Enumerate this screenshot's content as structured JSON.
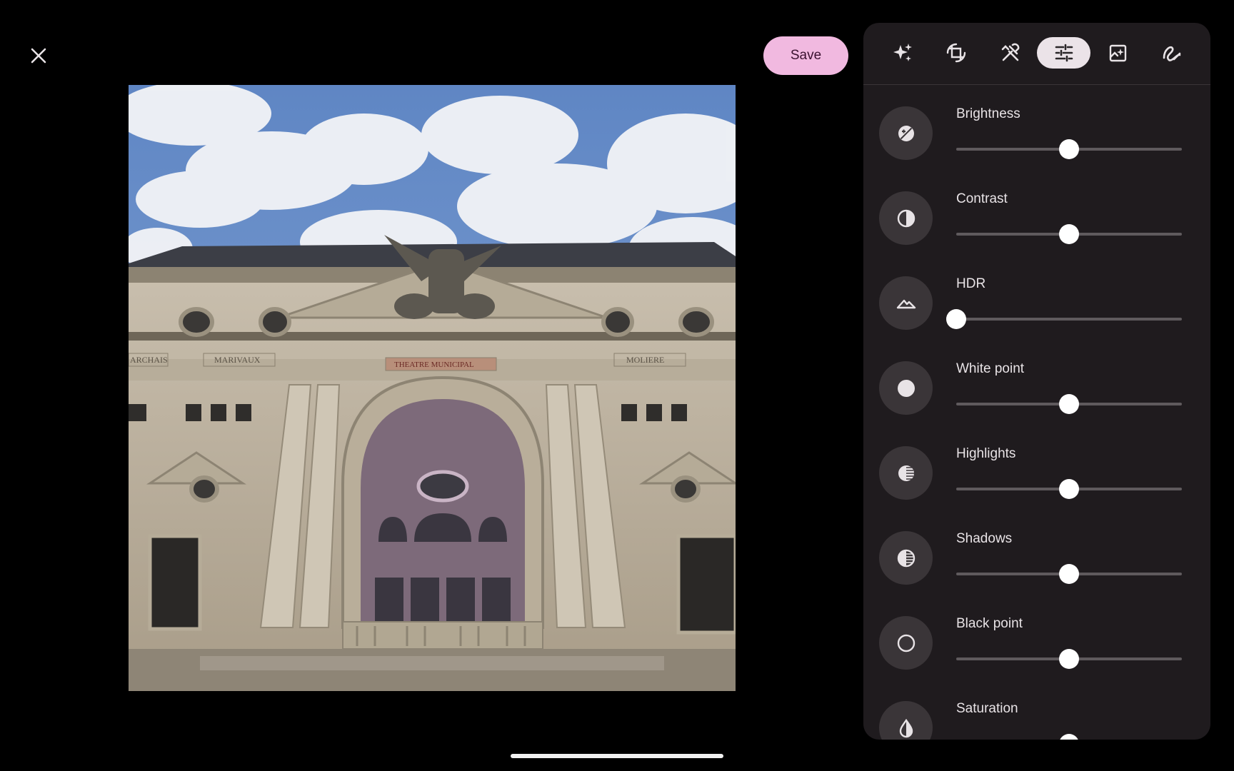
{
  "header": {
    "save_label": "Save"
  },
  "toolbar": {
    "tools": [
      {
        "name": "suggestions",
        "icon": "sparkle-icon"
      },
      {
        "name": "crop",
        "icon": "crop-rotate-icon"
      },
      {
        "name": "tools",
        "icon": "tools-icon"
      },
      {
        "name": "adjust",
        "icon": "sliders-icon",
        "active": true
      },
      {
        "name": "filters",
        "icon": "filter-add-icon"
      },
      {
        "name": "markup",
        "icon": "markup-icon"
      }
    ]
  },
  "adjustments": [
    {
      "label": "Brightness",
      "icon": "brightness-icon",
      "value": 0.5
    },
    {
      "label": "Contrast",
      "icon": "contrast-icon",
      "value": 0.5
    },
    {
      "label": "HDR",
      "icon": "hdr-icon",
      "value": 0.0
    },
    {
      "label": "White point",
      "icon": "white-point-icon",
      "value": 0.5
    },
    {
      "label": "Highlights",
      "icon": "highlights-icon",
      "value": 0.5
    },
    {
      "label": "Shadows",
      "icon": "shadows-icon",
      "value": 0.5
    },
    {
      "label": "Black point",
      "icon": "black-point-icon",
      "value": 0.5
    },
    {
      "label": "Saturation",
      "icon": "saturation-icon",
      "value": 0.5
    }
  ],
  "photo": {
    "facade_labels": [
      "ARCHAIS",
      "MARIVAUX",
      "THEATRE MUNICIPAL",
      "MOLIERE"
    ]
  },
  "colors": {
    "accent": "#f1b9e0",
    "panel": "#1f1b1e",
    "icon_bg": "#3a3538"
  }
}
